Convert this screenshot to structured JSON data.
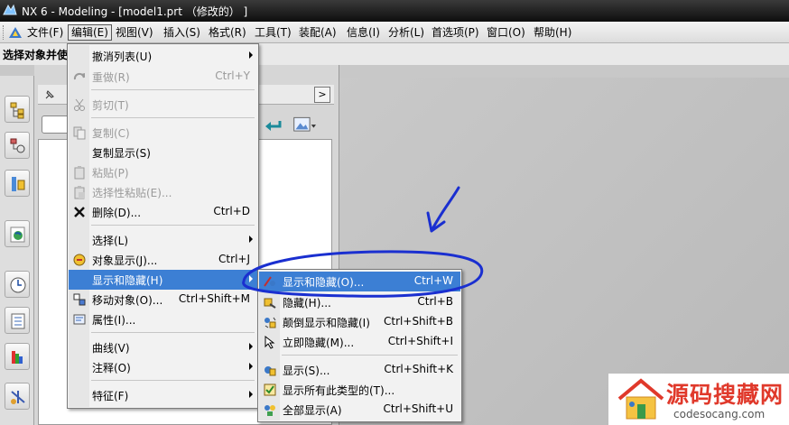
{
  "window": {
    "title": "NX 6 - Modeling - [model1.prt （修改的） ]"
  },
  "menubar": {
    "items": [
      "文件(F)",
      "编辑(E)",
      "视图(V)",
      "插入(S)",
      "格式(R)",
      "工具(T)",
      "装配(A)",
      "信息(I)",
      "分析(L)",
      "首选项(P)",
      "窗口(O)",
      "帮助(H)"
    ],
    "active_index": 1
  },
  "toolbar": {
    "prompt": "选择对象并使"
  },
  "edit_menu": {
    "items": [
      {
        "label": "撤消列表(U)",
        "shortcut": "",
        "submenu": true,
        "disabled": false,
        "icon": "none"
      },
      {
        "label": "重做(R)",
        "shortcut": "Ctrl+Y",
        "submenu": false,
        "disabled": true,
        "icon": "redo-icon"
      },
      {
        "label": "剪切(T)",
        "shortcut": "",
        "submenu": false,
        "disabled": true,
        "icon": "cut-icon"
      },
      {
        "label": "复制(C)",
        "shortcut": "",
        "submenu": false,
        "disabled": true,
        "icon": "copy-icon"
      },
      {
        "label": "复制显示(S)",
        "shortcut": "",
        "submenu": false,
        "disabled": false,
        "icon": "none"
      },
      {
        "label": "粘贴(P)",
        "shortcut": "",
        "submenu": false,
        "disabled": true,
        "icon": "paste-icon"
      },
      {
        "label": "选择性粘贴(E)...",
        "shortcut": "",
        "submenu": false,
        "disabled": true,
        "icon": "paste-special-icon"
      },
      {
        "label": "删除(D)...",
        "shortcut": "Ctrl+D",
        "submenu": false,
        "disabled": false,
        "icon": "delete-icon"
      },
      {
        "label": "选择(L)",
        "shortcut": "",
        "submenu": true,
        "disabled": false,
        "icon": "none"
      },
      {
        "label": "对象显示(J)...",
        "shortcut": "Ctrl+J",
        "submenu": false,
        "disabled": false,
        "icon": "object-display-icon"
      },
      {
        "label": "显示和隐藏(H)",
        "shortcut": "",
        "submenu": true,
        "disabled": false,
        "icon": "none",
        "highlighted": true
      },
      {
        "label": "移动对象(O)...",
        "shortcut": "Ctrl+Shift+M",
        "submenu": false,
        "disabled": false,
        "icon": "move-object-icon"
      },
      {
        "label": "属性(I)...",
        "shortcut": "",
        "submenu": false,
        "disabled": false,
        "icon": "properties-icon"
      },
      {
        "label": "曲线(V)",
        "shortcut": "",
        "submenu": true,
        "disabled": false,
        "icon": "none"
      },
      {
        "label": "注释(O)",
        "shortcut": "",
        "submenu": true,
        "disabled": false,
        "icon": "none"
      },
      {
        "label": "特征(F)",
        "shortcut": "",
        "submenu": true,
        "disabled": false,
        "icon": "none"
      }
    ]
  },
  "show_hide_submenu": {
    "items": [
      {
        "label": "显示和隐藏(O)...",
        "shortcut": "Ctrl+W",
        "icon": "show-hide-icon",
        "highlighted": true
      },
      {
        "label": "隐藏(H)...",
        "shortcut": "Ctrl+B",
        "icon": "hide-icon"
      },
      {
        "label": "颠倒显示和隐藏(I)",
        "shortcut": "Ctrl+Shift+B",
        "icon": "invert-show-hide-icon"
      },
      {
        "label": "立即隐藏(M)...",
        "shortcut": "Ctrl+Shift+I",
        "icon": "immediate-hide-icon"
      },
      {
        "label": "显示(S)...",
        "shortcut": "Ctrl+Shift+K",
        "icon": "show-icon"
      },
      {
        "label": "显示所有此类型的(T)...",
        "shortcut": "",
        "icon": "show-all-of-type-icon"
      },
      {
        "label": "全部显示(A)",
        "shortcut": "Ctrl+Shift+U",
        "icon": "show-all-icon"
      }
    ]
  },
  "watermark": {
    "brand": "源码搜藏网",
    "url": "codesocang.com"
  },
  "colors": {
    "highlight": "#3c7fd4",
    "annotation": "#1a2fd0",
    "watermark_red": "#e0392b"
  }
}
